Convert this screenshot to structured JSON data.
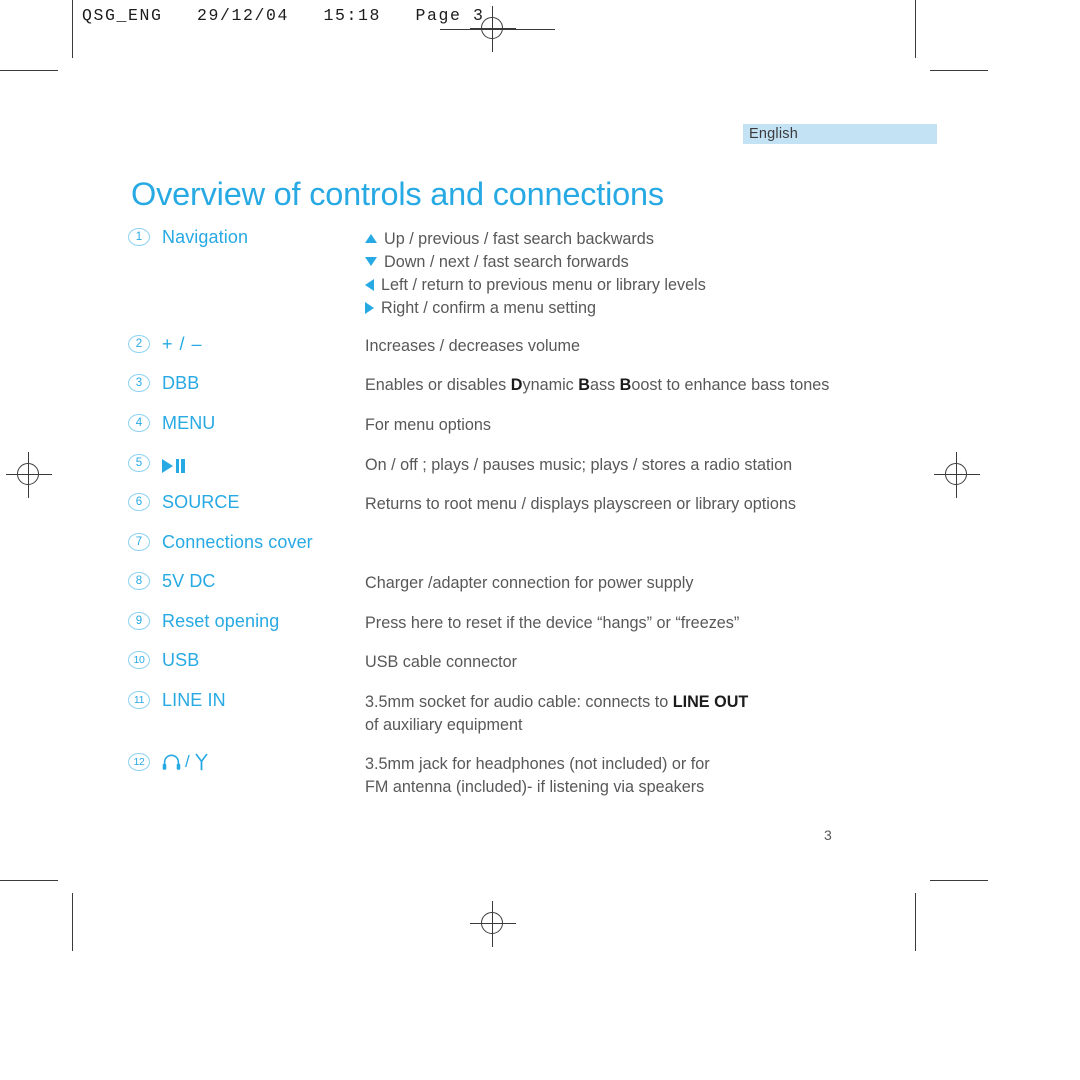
{
  "print_slug": {
    "text": "QSG_ENG   29/12/04   15:18   Page 3"
  },
  "language_badge": {
    "label": "English"
  },
  "page_title": "Overview of controls and connections",
  "page_number": "3",
  "colors": {
    "accent_blue": "#27a9e3",
    "badge_background": "#c3e3f4",
    "body_text": "#58585a",
    "emphasis_text": "#1c1c1c",
    "circle_outline": "#8ed3f2"
  },
  "controls": [
    {
      "number": "1",
      "label": "Navigation",
      "icon": null,
      "desc_lines": [
        {
          "arrow": "up-triangle-icon",
          "text": "Up / previous / fast search backwards"
        },
        {
          "arrow": "down-triangle-icon",
          "text": "Down / next / fast search forwards"
        },
        {
          "arrow": "left-triangle-icon",
          "text": "Left / return to previous menu or library levels"
        },
        {
          "arrow": "right-triangle-icon",
          "text": "Right / confirm a menu setting"
        }
      ]
    },
    {
      "number": "2",
      "label": "+ / –",
      "icon": "plus-minus-icon",
      "desc_lines": [
        {
          "arrow": null,
          "text": "Increases / decreases volume"
        }
      ]
    },
    {
      "number": "3",
      "label": "DBB",
      "icon": null,
      "desc_rich": [
        {
          "text": "Enables or disables ",
          "bold": false
        },
        {
          "text": "D",
          "bold": true
        },
        {
          "text": "ynamic ",
          "bold": false
        },
        {
          "text": "B",
          "bold": true
        },
        {
          "text": "ass ",
          "bold": false
        },
        {
          "text": "B",
          "bold": true
        },
        {
          "text": "oost to enhance bass tones",
          "bold": false
        }
      ]
    },
    {
      "number": "4",
      "label": "MENU",
      "icon": null,
      "desc_lines": [
        {
          "arrow": null,
          "text": "For menu options"
        }
      ]
    },
    {
      "number": "5",
      "label": "",
      "icon": "play-pause-icon",
      "desc_lines": [
        {
          "arrow": null,
          "text": "On / off ; plays / pauses music; plays / stores a radio station"
        }
      ]
    },
    {
      "number": "6",
      "label": "SOURCE",
      "icon": null,
      "desc_lines": [
        {
          "arrow": null,
          "text": "Returns to root menu / displays playscreen or library options"
        }
      ]
    },
    {
      "number": "7",
      "label": "Connections cover",
      "icon": null,
      "desc_lines": []
    },
    {
      "number": "8",
      "label": "5V DC",
      "icon": null,
      "desc_lines": [
        {
          "arrow": null,
          "text": "Charger /adapter connection for power supply"
        }
      ]
    },
    {
      "number": "9",
      "label": "Reset opening",
      "icon": null,
      "desc_lines": [
        {
          "arrow": null,
          "text": "Press here to reset if the device “hangs” or “freezes”"
        }
      ]
    },
    {
      "number": "10",
      "label": "USB",
      "icon": null,
      "desc_lines": [
        {
          "arrow": null,
          "text": "USB cable connector"
        }
      ]
    },
    {
      "number": "11",
      "label": "LINE IN",
      "icon": null,
      "desc_rich": [
        {
          "text": "3.5mm socket for audio cable: connects to ",
          "bold": false
        },
        {
          "text": "LINE OUT",
          "bold": true
        }
      ],
      "desc_extra_lines": [
        "of auxiliary equipment"
      ]
    },
    {
      "number": "12",
      "label": "",
      "icon": "headphone-antenna-icon",
      "icon_separator": "/",
      "desc_lines": [
        {
          "arrow": null,
          "text": "3.5mm jack for headphones (not included) or for"
        },
        {
          "arrow": null,
          "text": "FM antenna (included)- if listening via speakers"
        }
      ]
    }
  ]
}
